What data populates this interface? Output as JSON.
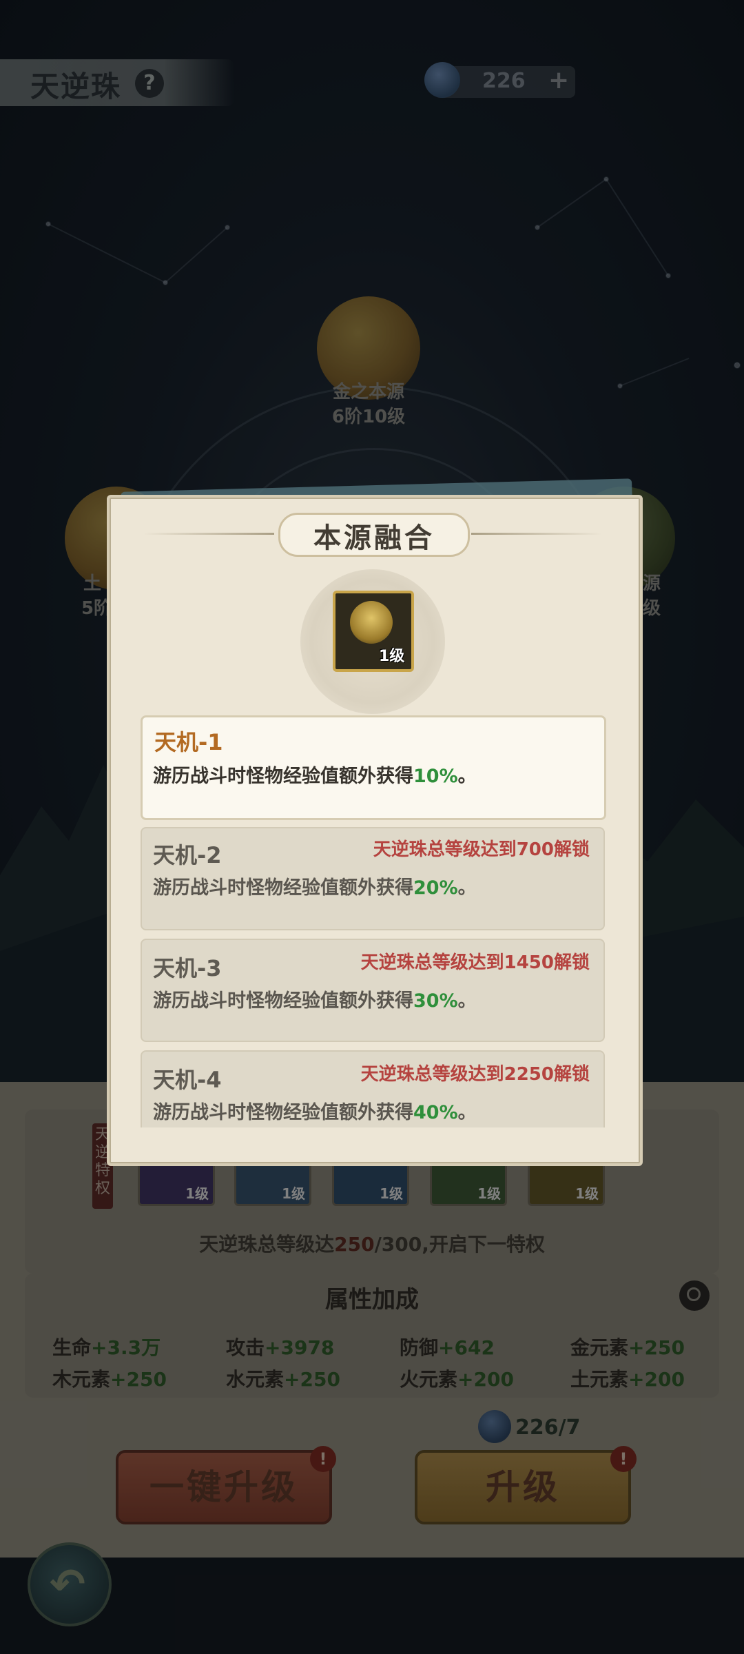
{
  "header": {
    "title": "天逆珠",
    "help_icon": "?",
    "currency": {
      "value": "226",
      "plus": "+"
    }
  },
  "scene": {
    "orbs": [
      {
        "label": "金之本源",
        "level": "6阶10级"
      },
      {
        "label": "土",
        "level": "5阶"
      },
      {
        "label": "源",
        "level": "级"
      }
    ]
  },
  "modal": {
    "title": "本源融合",
    "skill_level": "1级",
    "rows": [
      {
        "name": "天机-1",
        "desc": "游历战斗时怪物经验值额外获得",
        "pct": "10%",
        "end": "。",
        "lock": ""
      },
      {
        "name": "天机-2",
        "desc": "游历战斗时怪物经验值额外获得",
        "pct": "20%",
        "end": "。",
        "lock": "天逆珠总等级达到700解锁"
      },
      {
        "name": "天机-3",
        "desc": "游历战斗时怪物经验值额外获得",
        "pct": "30%",
        "end": "。",
        "lock": "天逆珠总等级达到1450解锁"
      },
      {
        "name": "天机-4",
        "desc": "游历战斗时怪物经验值额外获得",
        "pct": "40%",
        "end": "。",
        "lock": "天逆珠总等级达到2250解锁"
      }
    ]
  },
  "bottom": {
    "perk_tag": "天逆特权",
    "perks": [
      "1级",
      "1级",
      "1级",
      "1级",
      "1级"
    ],
    "next_perk": {
      "pre": "天逆珠总等级达",
      "cur": "250",
      "rest": "/300,开启下一特权"
    },
    "attr_title": "属性加成",
    "attrs": [
      {
        "name": "生命",
        "val": "+3.3万"
      },
      {
        "name": "攻击",
        "val": "+3978"
      },
      {
        "name": "防御",
        "val": "+642"
      },
      {
        "name": "金元素",
        "val": "+250"
      },
      {
        "name": "木元素",
        "val": "+250"
      },
      {
        "name": "水元素",
        "val": "+250"
      },
      {
        "name": "火元素",
        "val": "+200"
      },
      {
        "name": "土元素",
        "val": "+200"
      }
    ],
    "stone_count": "226/7",
    "btn_all": "一键升级",
    "btn_up": "升级",
    "badge": "!"
  },
  "colors": {
    "accent_green": "#2f8f3b",
    "lock_red": "#b5433f",
    "active_name": "#b36a22"
  }
}
